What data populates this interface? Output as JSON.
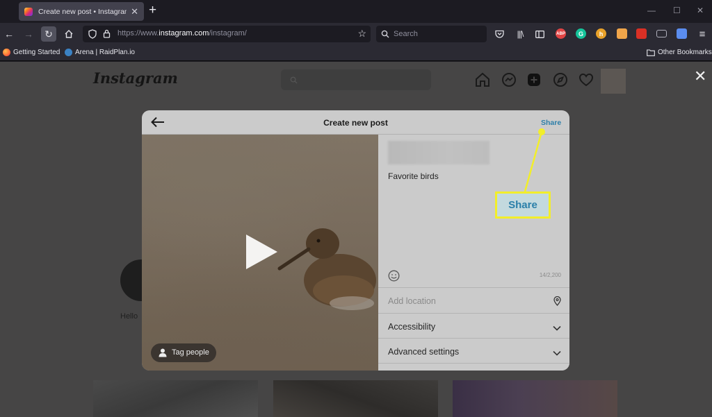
{
  "browser": {
    "tab_title": "Create new post • Instagram",
    "url_prefix": "https://www.",
    "url_domain": "instagram.com",
    "url_path": "/instagram/",
    "search_placeholder": "Search",
    "bookmarks": [
      {
        "label": "Getting Started",
        "icon": "firefox-icon"
      },
      {
        "label": "Arena | RaidPlan.io",
        "icon": "raidplan-icon"
      }
    ],
    "other_bookmarks": "Other Bookmarks",
    "extensions": [
      {
        "icon": "abp-icon",
        "text": "ABP",
        "color": "#e04444"
      },
      {
        "icon": "grammarly-icon",
        "text": "G",
        "color": "#15c39a"
      },
      {
        "icon": "honey-icon",
        "text": "h",
        "color": "#e8a12a"
      },
      {
        "icon": "tampermonkey-icon",
        "text": "",
        "color": "#f0a54a"
      },
      {
        "icon": "pdf-icon",
        "text": "",
        "color": "#d93025"
      },
      {
        "icon": "screenshot-icon",
        "text": "",
        "color": "#b0b0bc"
      },
      {
        "icon": "container-icon",
        "text": "",
        "color": "#5b8def"
      }
    ]
  },
  "instagram": {
    "logo": "Instagram",
    "story_name": "Hello",
    "modal": {
      "title": "Create new post",
      "share_label": "Share",
      "tag_people_label": "Tag people",
      "caption": "Favorite birds",
      "char_count": "14/2,200",
      "add_location_placeholder": "Add location",
      "accessibility_label": "Accessibility",
      "advanced_settings_label": "Advanced settings"
    }
  },
  "callout": {
    "label": "Share",
    "border_color": "#f2ee2a",
    "text_color": "#2a7fa9"
  }
}
